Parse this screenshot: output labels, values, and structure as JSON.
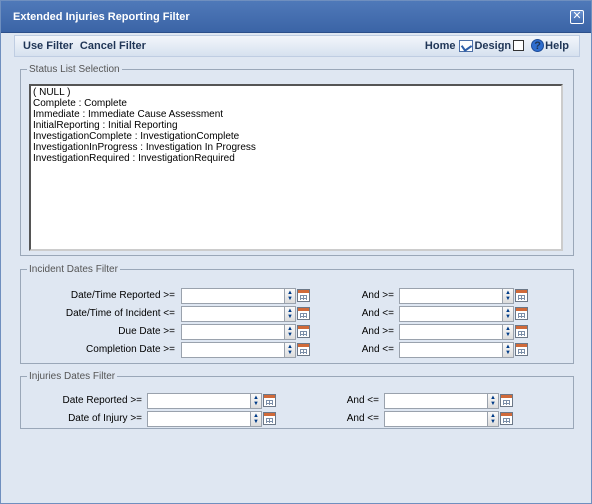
{
  "window": {
    "title": "Extended Injuries Reporting Filter",
    "close_glyph": "✕"
  },
  "toolbar": {
    "use_filter": "Use Filter",
    "cancel_filter": "Cancel Filter",
    "home": "Home",
    "design": "Design",
    "help": "Help"
  },
  "status_list": {
    "legend": "Status List Selection",
    "items": [
      "( NULL )",
      "Complete : Complete",
      "Immediate : Immediate Cause Assessment",
      "InitialReporting : Initial Reporting",
      "InvestigationComplete : InvestigationComplete",
      "InvestigationInProgress : Investigation In Progress",
      "InvestigationRequired : InvestigationRequired"
    ]
  },
  "incident_dates": {
    "legend": "Incident Dates Filter",
    "rows": [
      {
        "label": "Date/Time Reported >=",
        "and_label": "And >=",
        "from": "",
        "to": ""
      },
      {
        "label": "Date/Time of Incident <=",
        "and_label": "And <=",
        "from": "",
        "to": ""
      },
      {
        "label": "Due Date >=",
        "and_label": "And >=",
        "from": "",
        "to": ""
      },
      {
        "label": "Completion Date >=",
        "and_label": "And <=",
        "from": "",
        "to": ""
      }
    ]
  },
  "injury_dates": {
    "legend": "Injuries Dates Filter",
    "rows": [
      {
        "label": "Date Reported >=",
        "and_label": "And <=",
        "from": "",
        "to": ""
      },
      {
        "label": "Date of Injury >=",
        "and_label": "And <=",
        "from": "",
        "to": ""
      }
    ]
  }
}
